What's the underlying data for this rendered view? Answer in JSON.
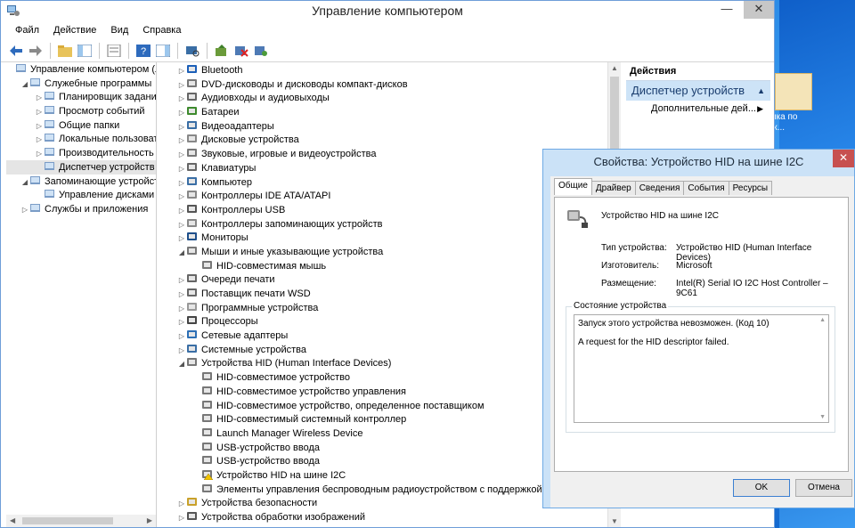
{
  "window": {
    "title": "Управление компьютером",
    "minimize": "—",
    "close": "✕"
  },
  "menu": [
    "Файл",
    "Действие",
    "Вид",
    "Справка"
  ],
  "left_tree": [
    {
      "label": "Управление компьютером (л",
      "level": 0,
      "expander": ""
    },
    {
      "label": "Служебные программы",
      "level": 1,
      "expander": "◢"
    },
    {
      "label": "Планировщик заданий",
      "level": 2,
      "expander": "▷"
    },
    {
      "label": "Просмотр событий",
      "level": 2,
      "expander": "▷"
    },
    {
      "label": "Общие папки",
      "level": 2,
      "expander": "▷"
    },
    {
      "label": "Локальные пользовате",
      "level": 2,
      "expander": "▷"
    },
    {
      "label": "Производительность",
      "level": 2,
      "expander": "▷"
    },
    {
      "label": "Диспетчер устройств",
      "level": 2,
      "expander": "",
      "selected": true
    },
    {
      "label": "Запоминающие устройст",
      "level": 1,
      "expander": "◢"
    },
    {
      "label": "Управление дисками",
      "level": 2,
      "expander": ""
    },
    {
      "label": "Службы и приложения",
      "level": 1,
      "expander": "▷"
    }
  ],
  "devices": [
    {
      "label": "Bluetooth",
      "level": 0,
      "expander": "▷",
      "icon": "bluetooth-icon"
    },
    {
      "label": "DVD-дисководы и дисководы компакт-дисков",
      "level": 0,
      "expander": "▷",
      "icon": "dvd-icon"
    },
    {
      "label": "Аудиовходы и аудиовыходы",
      "level": 0,
      "expander": "▷",
      "icon": "audio-icon"
    },
    {
      "label": "Батареи",
      "level": 0,
      "expander": "▷",
      "icon": "battery-icon"
    },
    {
      "label": "Видеоадаптеры",
      "level": 0,
      "expander": "▷",
      "icon": "display-adapter-icon"
    },
    {
      "label": "Дисковые устройства",
      "level": 0,
      "expander": "▷",
      "icon": "disk-icon"
    },
    {
      "label": "Звуковые, игровые и видеоустройства",
      "level": 0,
      "expander": "▷",
      "icon": "sound-icon"
    },
    {
      "label": "Клавиатуры",
      "level": 0,
      "expander": "▷",
      "icon": "keyboard-icon"
    },
    {
      "label": "Компьютер",
      "level": 0,
      "expander": "▷",
      "icon": "computer-icon"
    },
    {
      "label": "Контроллеры IDE ATA/ATAPI",
      "level": 0,
      "expander": "▷",
      "icon": "ide-icon"
    },
    {
      "label": "Контроллеры USB",
      "level": 0,
      "expander": "▷",
      "icon": "usb-icon"
    },
    {
      "label": "Контроллеры запоминающих устройств",
      "level": 0,
      "expander": "▷",
      "icon": "storage-controller-icon"
    },
    {
      "label": "Мониторы",
      "level": 0,
      "expander": "▷",
      "icon": "monitor-icon"
    },
    {
      "label": "Мыши и иные указывающие устройства",
      "level": 0,
      "expander": "◢",
      "icon": "mouse-icon"
    },
    {
      "label": "HID-совместимая мышь",
      "level": 1,
      "expander": "",
      "icon": "mouse-icon"
    },
    {
      "label": "Очереди печати",
      "level": 0,
      "expander": "▷",
      "icon": "printer-icon"
    },
    {
      "label": "Поставщик печати WSD",
      "level": 0,
      "expander": "▷",
      "icon": "printer-icon"
    },
    {
      "label": "Программные устройства",
      "level": 0,
      "expander": "▷",
      "icon": "software-device-icon"
    },
    {
      "label": "Процессоры",
      "level": 0,
      "expander": "▷",
      "icon": "processor-icon"
    },
    {
      "label": "Сетевые адаптеры",
      "level": 0,
      "expander": "▷",
      "icon": "network-icon"
    },
    {
      "label": "Системные устройства",
      "level": 0,
      "expander": "▷",
      "icon": "system-device-icon"
    },
    {
      "label": "Устройства HID (Human Interface Devices)",
      "level": 0,
      "expander": "◢",
      "icon": "hid-icon"
    },
    {
      "label": "HID-совместимое устройство",
      "level": 1,
      "expander": "",
      "icon": "hid-icon"
    },
    {
      "label": "HID-совместимое устройство управления",
      "level": 1,
      "expander": "",
      "icon": "hid-icon"
    },
    {
      "label": "HID-совместимое устройство, определенное поставщиком",
      "level": 1,
      "expander": "",
      "icon": "hid-icon"
    },
    {
      "label": "HID-совместимый системный контроллер",
      "level": 1,
      "expander": "",
      "icon": "hid-icon"
    },
    {
      "label": "Launch Manager Wireless Device",
      "level": 1,
      "expander": "",
      "icon": "hid-icon"
    },
    {
      "label": "USB-устройство ввода",
      "level": 1,
      "expander": "",
      "icon": "hid-icon"
    },
    {
      "label": "USB-устройство ввода",
      "level": 1,
      "expander": "",
      "icon": "hid-icon"
    },
    {
      "label": "Устройство HID на шине I2C",
      "level": 1,
      "expander": "",
      "icon": "hid-warning-icon"
    },
    {
      "label": "Элементы управления беспроводным радиоустройством с поддержкой HI",
      "level": 1,
      "expander": "",
      "icon": "hid-icon"
    },
    {
      "label": "Устройства безопасности",
      "level": 0,
      "expander": "▷",
      "icon": "security-icon"
    },
    {
      "label": "Устройства обработки изображений",
      "level": 0,
      "expander": "▷",
      "icon": "camera-icon"
    }
  ],
  "actions": {
    "header": "Действия",
    "selected": "Диспетчер устройств",
    "more": "Дополнительные дей..."
  },
  "desktop": {
    "icon_label": "ика по\nж..."
  },
  "dialog": {
    "title": "Свойства: Устройство HID на шине I2C",
    "close": "✕",
    "tabs": [
      "Общие",
      "Драйвер",
      "Сведения",
      "События",
      "Ресурсы"
    ],
    "device_name": "Устройство HID на шине I2C",
    "props": [
      {
        "label": "Тип устройства:",
        "value": "Устройство HID (Human Interface Devices)"
      },
      {
        "label": "Изготовитель:",
        "value": "Microsoft"
      },
      {
        "label": "Размещение:",
        "value": "Intel(R) Serial IO I2C Host Controller – 9C61"
      }
    ],
    "status_title": "Состояние устройства",
    "status_line1": "Запуск этого устройства невозможен. (Код 10)",
    "status_line2": "A request for the HID descriptor failed.",
    "ok": "OK",
    "cancel": "Отмена"
  }
}
